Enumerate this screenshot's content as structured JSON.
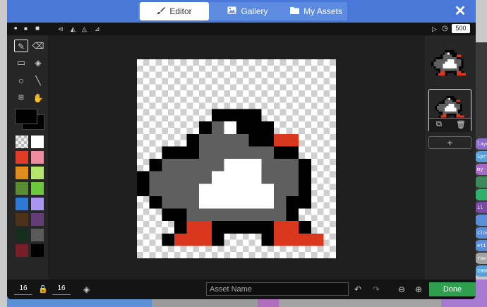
{
  "header": {
    "tabs": [
      {
        "label": "Editor",
        "icon": "brush-icon",
        "active": true
      },
      {
        "label": "Gallery",
        "icon": "image-icon",
        "active": false
      },
      {
        "label": "My Assets",
        "icon": "folder-icon",
        "active": false
      }
    ],
    "close_icon": "close-icon"
  },
  "toolbar": {
    "frame_interval": "500"
  },
  "bottombar": {
    "width": "16",
    "height": "16",
    "asset_name_placeholder": "Asset Name",
    "done_label": "Done"
  },
  "palette": [
    "transparent",
    "#ffffff",
    "#e03c28",
    "#f08ca0",
    "#e08c1e",
    "#b4e66e",
    "#5a8c32",
    "#6ec83c",
    "#2d78d2",
    "#aa96f0",
    "#4b3219",
    "#643c78",
    "#142d1e",
    "#5a5a5a",
    "#781e28",
    "#000000"
  ],
  "sprite": {
    "grid": 16,
    "colors": {
      "k": "#000000",
      "g": "#5f5f5f",
      "w": "#ffffff",
      "r": "#d9381e"
    },
    "rows": [
      "................",
      "................",
      "................",
      "................",
      "......kkkk......",
      ".....kgwkkk.....",
      "....kggggkkrr...",
      "..kkkggggggkk...",
      ".kgggggwwwgggk..",
      "kgggggwwwwgggk..",
      "kggggwwwwwwggk..",
      ".kgggwwwwwwgkk..",
      "..kkggggggggk...",
      "...krrkkkkkrrk..",
      "..krrrk...krrrr.",
      "................"
    ]
  },
  "background_tags": [
    "layer",
    "Spri",
    "my",
    "",
    "",
    "il (m",
    "",
    "cloc",
    "etil",
    "row",
    "2000"
  ]
}
